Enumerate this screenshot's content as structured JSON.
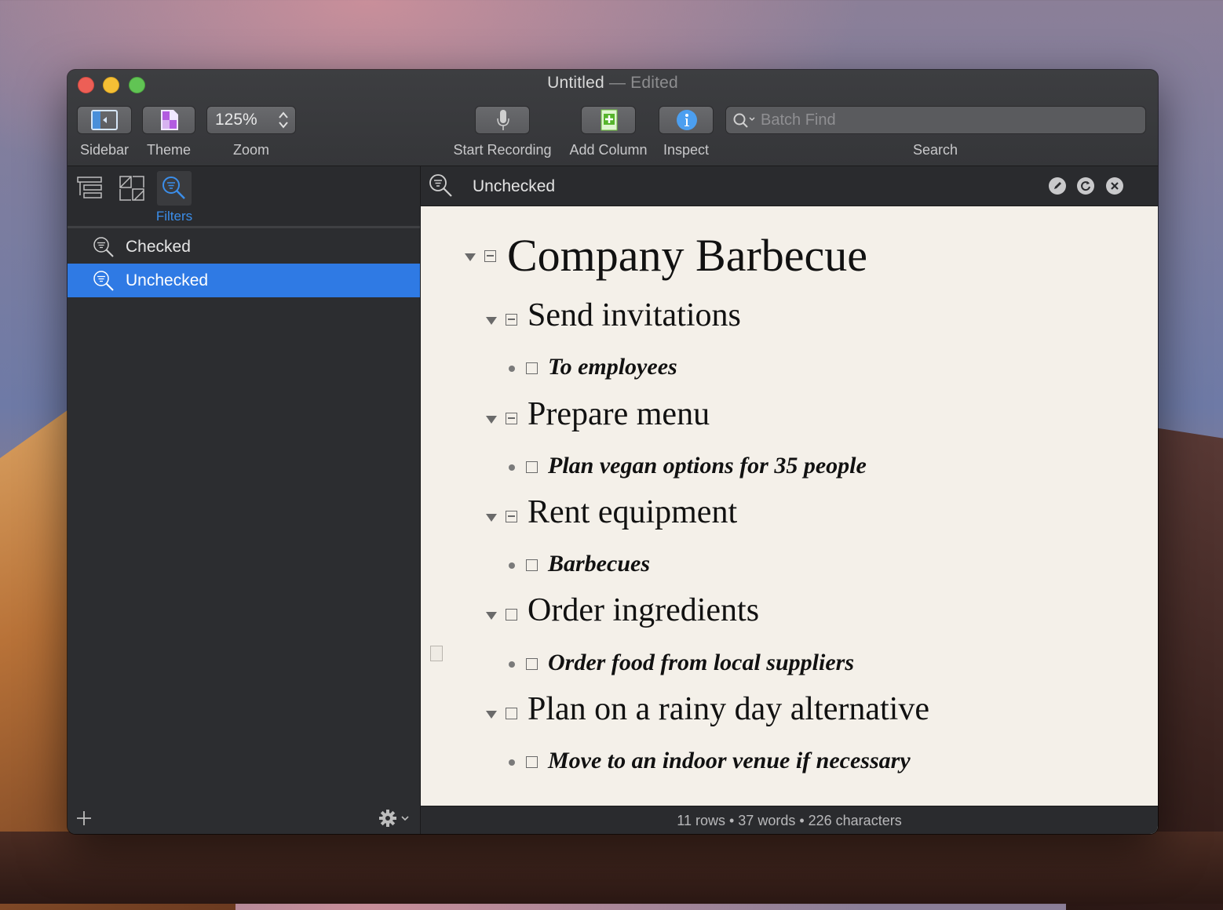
{
  "window": {
    "title": "Untitled",
    "title_suffix": "— Edited"
  },
  "toolbar": {
    "sidebar_label": "Sidebar",
    "theme_label": "Theme",
    "zoom_value": "125%",
    "zoom_label": "Zoom",
    "record_label": "Start Recording",
    "add_column_label": "Add Column",
    "inspect_label": "Inspect",
    "search_placeholder": "Batch Find",
    "search_label": "Search"
  },
  "sidebar": {
    "active_tab_label": "Filters",
    "items": [
      {
        "label": "Checked",
        "selected": false
      },
      {
        "label": "Unchecked",
        "selected": true
      }
    ]
  },
  "filter_bar": {
    "title": "Unchecked"
  },
  "outline": {
    "root": "Company Barbecue",
    "sections": [
      {
        "title": "Send invitations",
        "child": "To employees"
      },
      {
        "title": "Prepare menu",
        "child": "Plan vegan options for 35 people"
      },
      {
        "title": "Rent equipment",
        "child": "Barbecues"
      },
      {
        "title": "Order ingredients",
        "child": "Order food from local suppliers"
      },
      {
        "title": "Plan on a rainy day alternative",
        "child": "Move to an indoor venue if necessary"
      }
    ]
  },
  "status": {
    "text": "11 rows • 37 words • 226 characters"
  },
  "colors": {
    "selection": "#2f7ae4",
    "accent": "#3b8eea",
    "paper": "#f4f0e9"
  }
}
